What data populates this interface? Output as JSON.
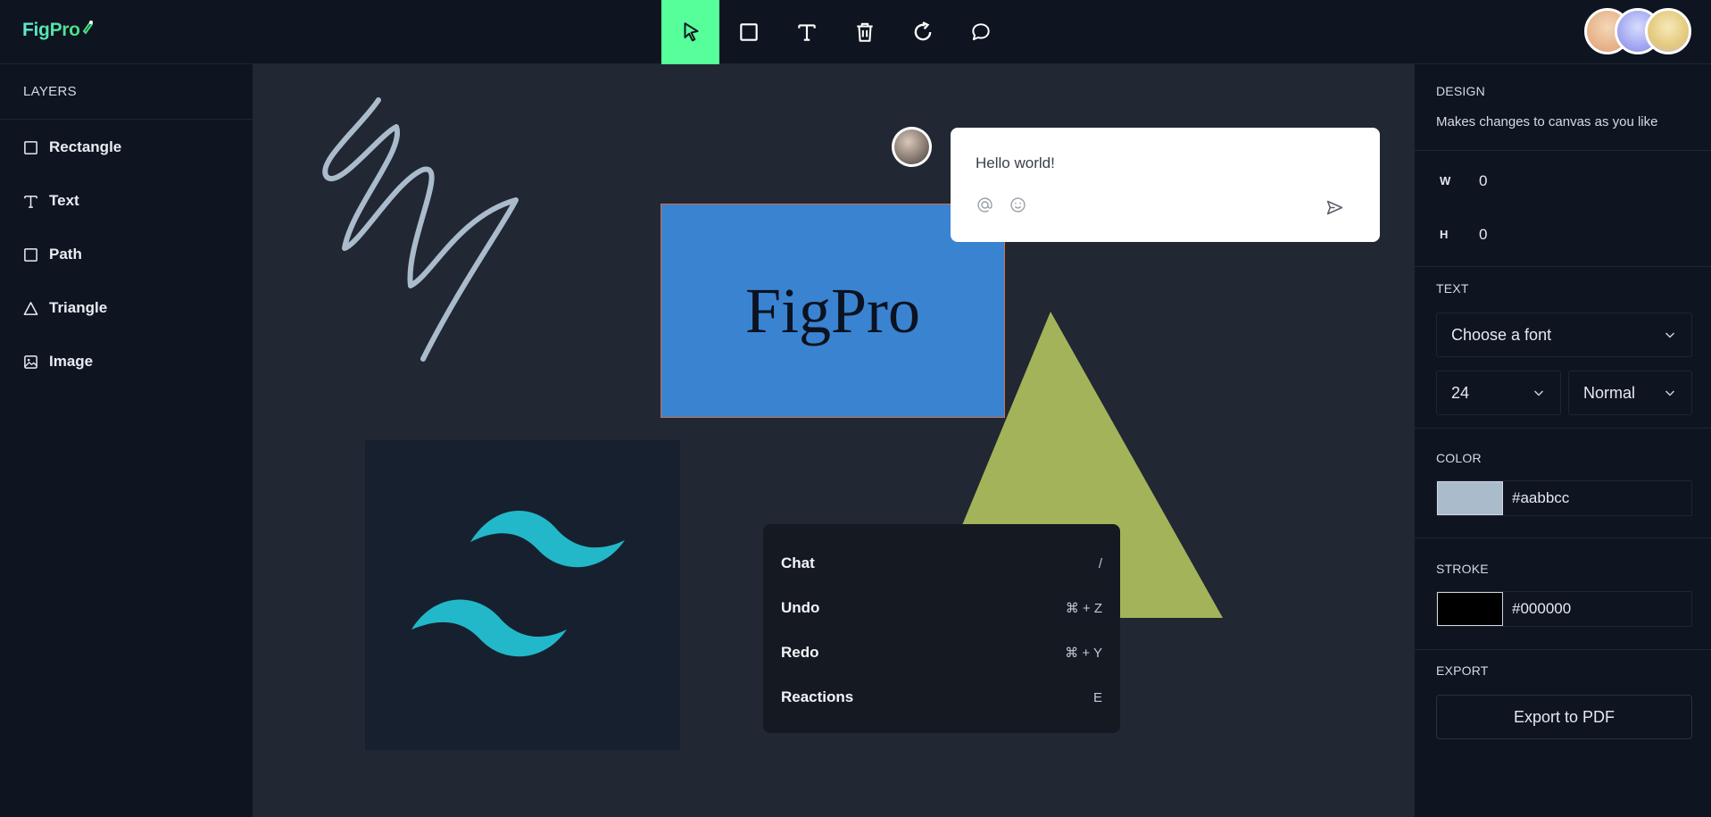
{
  "app": {
    "name": "FigPro"
  },
  "toolbar": {
    "tools": [
      {
        "name": "select",
        "icon": "cursor-icon",
        "active": true
      },
      {
        "name": "rectangle",
        "icon": "square-icon",
        "active": false
      },
      {
        "name": "text",
        "icon": "text-icon",
        "active": false
      },
      {
        "name": "delete",
        "icon": "trash-icon",
        "active": false
      },
      {
        "name": "reset",
        "icon": "reset-icon",
        "active": false
      },
      {
        "name": "comments",
        "icon": "comment-icon",
        "active": false
      }
    ],
    "active_color": "#56ff99"
  },
  "layers": {
    "title": "LAYERS",
    "items": [
      {
        "label": "Rectangle",
        "icon": "square-icon"
      },
      {
        "label": "Text",
        "icon": "text-icon"
      },
      {
        "label": "Path",
        "icon": "square-icon"
      },
      {
        "label": "Triangle",
        "icon": "triangle-icon"
      },
      {
        "label": "Image",
        "icon": "image-icon"
      }
    ]
  },
  "canvas": {
    "rect_text": "FigPro",
    "rect_color": "#3a83d0",
    "triangle_color": "#a3b35a",
    "path_color": "#aabbcc",
    "comment": {
      "text": "Hello world!"
    },
    "context_menu": [
      {
        "label": "Chat",
        "shortcut": "/"
      },
      {
        "label": "Undo",
        "shortcut": "⌘ + Z"
      },
      {
        "label": "Redo",
        "shortcut": "⌘ + Y"
      },
      {
        "label": "Reactions",
        "shortcut": "E"
      }
    ]
  },
  "design": {
    "title": "DESIGN",
    "description": "Makes changes to canvas as you like",
    "width_label": "W",
    "width_value": "0",
    "height_label": "H",
    "height_value": "0",
    "text_title": "TEXT",
    "font_placeholder": "Choose a font",
    "font_size": "24",
    "font_weight": "Normal",
    "color_title": "COLOR",
    "color_value": "#aabbcc",
    "stroke_title": "STROKE",
    "stroke_value": "#000000",
    "export_title": "EXPORT",
    "export_button": "Export to PDF"
  }
}
